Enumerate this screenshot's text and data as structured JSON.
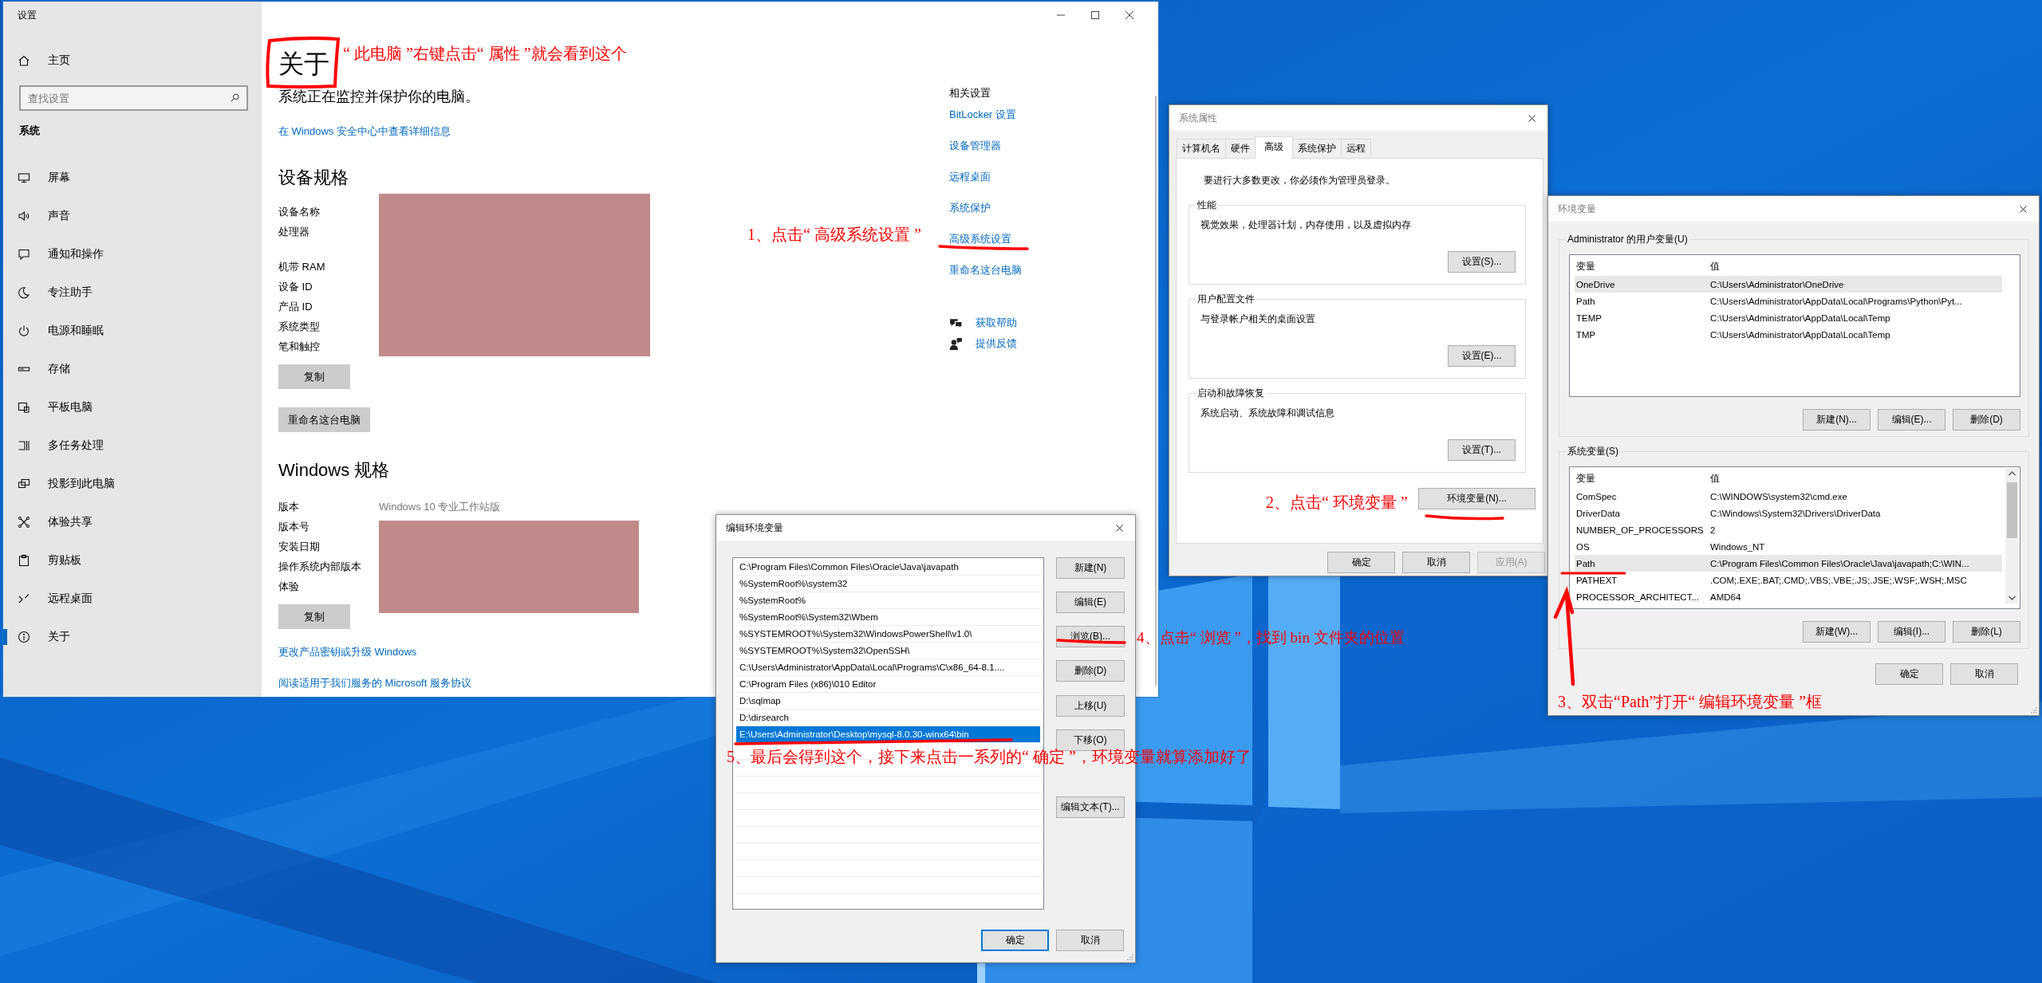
{
  "settings_window": {
    "title": "设置",
    "home": "主页",
    "search": {
      "placeholder": "查找设置"
    },
    "section": "系统",
    "nav": [
      {
        "label": "屏幕",
        "selected": false
      },
      {
        "label": "声音",
        "selected": false
      },
      {
        "label": "通知和操作",
        "selected": false
      },
      {
        "label": "专注助手",
        "selected": false
      },
      {
        "label": "电源和睡眠",
        "selected": false
      },
      {
        "label": "存储",
        "selected": false
      },
      {
        "label": "平板电脑",
        "selected": false
      },
      {
        "label": "多任务处理",
        "selected": false
      },
      {
        "label": "投影到此电脑",
        "selected": false
      },
      {
        "label": "体验共享",
        "selected": false
      },
      {
        "label": "剪贴板",
        "selected": false
      },
      {
        "label": "远程桌面",
        "selected": false
      },
      {
        "label": "关于",
        "selected": true
      }
    ],
    "heading": "关于",
    "status": "系统正在监控并保护你的电脑。",
    "security_link": "在 Windows 安全中心中查看详细信息",
    "device_specs": {
      "title": "设备规格",
      "rows": [
        {
          "label": "设备名称"
        },
        {
          "label": "处理器"
        },
        {
          "label": "机带 RAM"
        },
        {
          "label": "设备 ID"
        },
        {
          "label": "产品 ID"
        },
        {
          "label": "系统类型"
        },
        {
          "label": "笔和触控"
        }
      ],
      "copy_button": "复制"
    },
    "rename_button": "重命名这台电脑",
    "windows_specs": {
      "title": "Windows 规格",
      "rows": [
        {
          "label": "版本",
          "value": "Windows 10 专业工作站版"
        },
        {
          "label": "版本号"
        },
        {
          "label": "安装日期"
        },
        {
          "label": "操作系统内部版本"
        },
        {
          "label": "体验"
        }
      ],
      "copy_button": "复制"
    },
    "links": [
      "更改产品密钥或升级 Windows",
      "阅读适用于我们服务的 Microsoft 服务协议"
    ],
    "related": {
      "title": "相关设置",
      "links": [
        "BitLocker 设置",
        "设备管理器",
        "远程桌面",
        "系统保护",
        "高级系统设置",
        "重命名这台电脑"
      ],
      "help": [
        "获取帮助",
        "提供反馈"
      ]
    }
  },
  "system_properties": {
    "title": "系统属性",
    "tabs": [
      {
        "label": "计算机名",
        "selected": false
      },
      {
        "label": "硬件",
        "selected": false
      },
      {
        "label": "高级",
        "selected": true
      },
      {
        "label": "系统保护",
        "selected": false
      },
      {
        "label": "远程",
        "selected": false
      }
    ],
    "notice": "要进行大多数更改，你必须作为管理员登录。",
    "groups": [
      {
        "title": "性能",
        "description": "视觉效果，处理器计划，内存使用，以及虚拟内存",
        "button": "设置(S)..."
      },
      {
        "title": "用户配置文件",
        "description": "与登录帐户相关的桌面设置",
        "button": "设置(E)..."
      },
      {
        "title": "启动和故障恢复",
        "description": "系统启动、系统故障和调试信息",
        "button": "设置(T)..."
      }
    ],
    "env_button": "环境变量(N)...",
    "buttons": [
      {
        "label": "确定",
        "disabled": false
      },
      {
        "label": "取消",
        "disabled": false
      },
      {
        "label": "应用(A)",
        "disabled": true
      }
    ]
  },
  "environment_variables": {
    "title": "环境变量",
    "user": {
      "title": "Administrator 的用户变量(U)",
      "columns": [
        "变量",
        "值"
      ],
      "rows": [
        {
          "name": "OneDrive",
          "value": "C:\\Users\\Administrator\\OneDrive",
          "selected": true
        },
        {
          "name": "Path",
          "value": "C:\\Users\\Administrator\\AppData\\Local\\Programs\\Python\\Pyt...",
          "selected": false
        },
        {
          "name": "TEMP",
          "value": "C:\\Users\\Administrator\\AppData\\Local\\Temp",
          "selected": false
        },
        {
          "name": "TMP",
          "value": "C:\\Users\\Administrator\\AppData\\Local\\Temp",
          "selected": false
        }
      ],
      "buttons": [
        "新建(N)...",
        "编辑(E)...",
        "删除(D)"
      ]
    },
    "system": {
      "title": "系统变量(S)",
      "columns": [
        "变量",
        "值"
      ],
      "rows": [
        {
          "name": "ComSpec",
          "value": "C:\\WINDOWS\\system32\\cmd.exe",
          "selected": false
        },
        {
          "name": "DriverData",
          "value": "C:\\Windows\\System32\\Drivers\\DriverData",
          "selected": false
        },
        {
          "name": "NUMBER_OF_PROCESSORS",
          "value": "2",
          "selected": false
        },
        {
          "name": "OS",
          "value": "Windows_NT",
          "selected": false
        },
        {
          "name": "Path",
          "value": "C:\\Program Files\\Common Files\\Oracle\\Java\\javapath;C:\\WIN...",
          "selected": true
        },
        {
          "name": "PATHEXT",
          "value": ".COM;.EXE;.BAT;.CMD;.VBS;.VBE;.JS;.JSE;.WSF;.WSH;.MSC",
          "selected": false
        },
        {
          "name": "PROCESSOR_ARCHITECT...",
          "value": "AMD64",
          "selected": false
        }
      ],
      "buttons": [
        "新建(W)...",
        "编辑(I)...",
        "删除(L)"
      ]
    },
    "buttons": [
      "确定",
      "取消"
    ]
  },
  "edit_variable": {
    "title": "编辑环境变量",
    "entries": [
      {
        "text": "C:\\Program Files\\Common Files\\Oracle\\Java\\javapath",
        "selected": false
      },
      {
        "text": "%SystemRoot%\\system32",
        "selected": false
      },
      {
        "text": "%SystemRoot%",
        "selected": false
      },
      {
        "text": "%SystemRoot%\\System32\\Wbem",
        "selected": false
      },
      {
        "text": "%SYSTEMROOT%\\System32\\WindowsPowerShell\\v1.0\\",
        "selected": false
      },
      {
        "text": "%SYSTEMROOT%\\System32\\OpenSSH\\",
        "selected": false
      },
      {
        "text": "C:\\Users\\Administrator\\AppData\\Local\\Programs\\C\\x86_64-8.1....",
        "selected": false
      },
      {
        "text": "C:\\Program Files (x86)\\010 Editor",
        "selected": false
      },
      {
        "text": "D:\\sqlmap",
        "selected": false
      },
      {
        "text": "D:\\dirsearch",
        "selected": false
      },
      {
        "text": "E:\\Users\\Administrator\\Desktop\\mysql-8.0.30-winx64\\bin",
        "selected": true
      }
    ],
    "side_button_groups": [
      [
        "新建(N)",
        "编辑(E)",
        "浏览(B)...",
        "删除(D)"
      ],
      [
        "上移(U)",
        "下移(O)"
      ],
      [
        "编辑文本(T)..."
      ]
    ],
    "buttons": [
      {
        "label": "确定",
        "default": true
      },
      {
        "label": "取消",
        "default": false
      }
    ]
  },
  "annotations": [
    {
      "text": "“ 此电脑 ”右键点击“ 属性 ”就会看到这个"
    },
    {
      "text": "1、点击“ 高级系统设置 ”"
    },
    {
      "text": "2、点击“ 环境变量 ”"
    },
    {
      "text": "3、双击“Path”打开“ 编辑环境变量 ”框"
    },
    {
      "text": "4、点击“ 浏览 ”，找到 bin 文件夹的位置"
    },
    {
      "text": "5、最后会得到这个，接下来点击一系列的“ 确定 ”，环境变量就算添加好了"
    }
  ]
}
